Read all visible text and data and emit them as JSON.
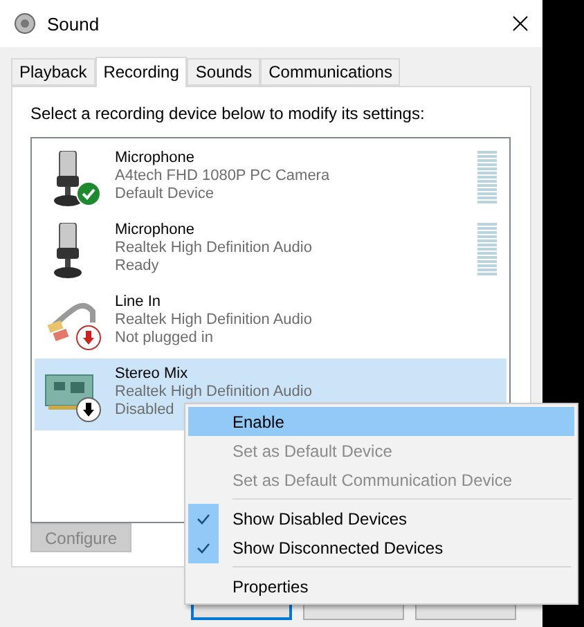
{
  "window": {
    "title": "Sound"
  },
  "tabs": [
    {
      "label": "Playback",
      "selected": false
    },
    {
      "label": "Recording",
      "selected": true
    },
    {
      "label": "Sounds",
      "selected": false
    },
    {
      "label": "Communications",
      "selected": false
    }
  ],
  "instruction": "Select a recording device below to modify its settings:",
  "devices": [
    {
      "name": "Microphone",
      "driver": "A4tech FHD 1080P PC Camera",
      "status": "Default Device",
      "kind": "microphone",
      "is_default": true,
      "plugged_in": true,
      "enabled": true,
      "meter": true,
      "selected": false
    },
    {
      "name": "Microphone",
      "driver": "Realtek High Definition Audio",
      "status": "Ready",
      "kind": "microphone",
      "is_default": false,
      "plugged_in": true,
      "enabled": true,
      "meter": true,
      "selected": false
    },
    {
      "name": "Line In",
      "driver": "Realtek High Definition Audio",
      "status": "Not plugged in",
      "kind": "line-in",
      "is_default": false,
      "plugged_in": false,
      "enabled": true,
      "meter": false,
      "selected": false
    },
    {
      "name": "Stereo Mix",
      "driver": "Realtek High Definition Audio",
      "status": "Disabled",
      "kind": "sound-card",
      "is_default": false,
      "plugged_in": true,
      "enabled": false,
      "meter": false,
      "selected": true
    }
  ],
  "configure_button": {
    "label": "Configure",
    "disabled": true
  },
  "context_menu": [
    {
      "kind": "item",
      "label": "Enable",
      "selected": true,
      "disabled": false,
      "checked": false
    },
    {
      "kind": "item",
      "label": "Set as Default Device",
      "selected": false,
      "disabled": true,
      "checked": false
    },
    {
      "kind": "item",
      "label": "Set as Default Communication Device",
      "selected": false,
      "disabled": true,
      "checked": false
    },
    {
      "kind": "separator"
    },
    {
      "kind": "item",
      "label": "Show Disabled Devices",
      "selected": false,
      "disabled": false,
      "checked": true
    },
    {
      "kind": "item",
      "label": "Show Disconnected Devices",
      "selected": false,
      "disabled": false,
      "checked": true
    },
    {
      "kind": "separator"
    },
    {
      "kind": "item",
      "label": "Properties",
      "selected": false,
      "disabled": false,
      "checked": false
    }
  ]
}
